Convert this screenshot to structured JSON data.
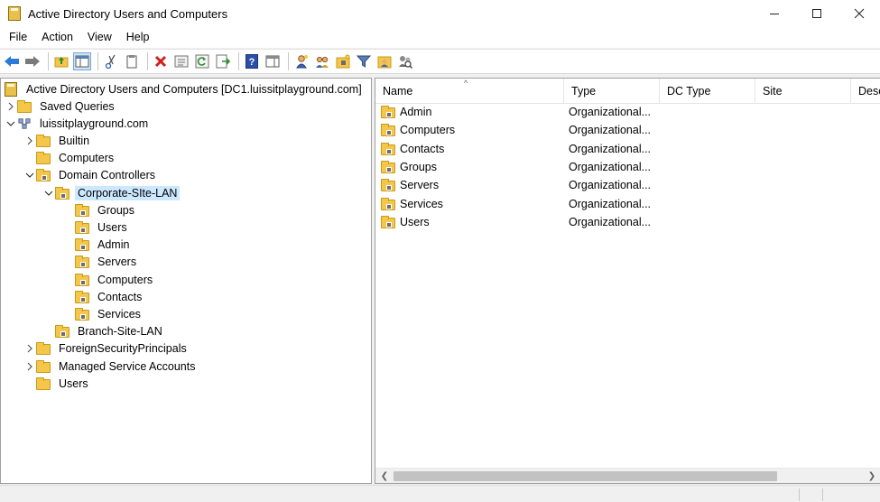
{
  "window": {
    "title": "Active Directory Users and Computers",
    "icon": "adsi-app-icon",
    "controls": [
      "minimize-icon",
      "maximize-icon",
      "close-icon"
    ]
  },
  "menu": {
    "items": [
      "File",
      "Action",
      "View",
      "Help"
    ]
  },
  "toolbar": {
    "buttons": [
      "back-arrow-icon",
      "forward-arrow-icon",
      "up-folder-icon",
      "show-hide-console-tree-icon",
      "cut-icon",
      "copy-icon",
      "delete-icon",
      "properties-icon",
      "refresh-icon",
      "export-list-icon",
      "help-icon",
      "show-action-pane-icon",
      "new-user-icon",
      "new-group-icon",
      "new-ou-icon",
      "filter-icon",
      "add-to-group-icon",
      "find-objects-icon"
    ]
  },
  "tree": {
    "root": "Active Directory Users and Computers [DC1.luissitplayground.com]",
    "items": [
      {
        "label": "Saved Queries",
        "level": 1,
        "expander": "collapsed",
        "icon": "folder"
      },
      {
        "label": "luissitplayground.com",
        "level": 1,
        "expander": "expanded",
        "icon": "domain"
      },
      {
        "label": "Builtin",
        "level": 2,
        "expander": "collapsed",
        "icon": "folder"
      },
      {
        "label": "Computers",
        "level": 2,
        "expander": "none",
        "icon": "folder"
      },
      {
        "label": "Domain Controllers",
        "level": 2,
        "expander": "expanded",
        "icon": "ou"
      },
      {
        "label": "Corporate-SIte-LAN",
        "level": 3,
        "expander": "expanded",
        "icon": "ou",
        "selected": true
      },
      {
        "label": "Groups",
        "level": 4,
        "expander": "none",
        "icon": "ou"
      },
      {
        "label": "Users",
        "level": 4,
        "expander": "none",
        "icon": "ou"
      },
      {
        "label": "Admin",
        "level": 4,
        "expander": "none",
        "icon": "ou"
      },
      {
        "label": "Servers",
        "level": 4,
        "expander": "none",
        "icon": "ou"
      },
      {
        "label": "Computers",
        "level": 4,
        "expander": "none",
        "icon": "ou"
      },
      {
        "label": "Contacts",
        "level": 4,
        "expander": "none",
        "icon": "ou"
      },
      {
        "label": "Services",
        "level": 4,
        "expander": "none",
        "icon": "ou"
      },
      {
        "label": "Branch-Site-LAN",
        "level": 3,
        "expander": "none",
        "icon": "ou"
      },
      {
        "label": "ForeignSecurityPrincipals",
        "level": 2,
        "expander": "collapsed",
        "icon": "folder"
      },
      {
        "label": "Managed Service Accounts",
        "level": 2,
        "expander": "collapsed",
        "icon": "folder"
      },
      {
        "label": "Users",
        "level": 2,
        "expander": "none",
        "icon": "folder"
      }
    ]
  },
  "list": {
    "columns": [
      "Name",
      "Type",
      "DC Type",
      "Site",
      "Desc"
    ],
    "rows": [
      {
        "name": "Admin",
        "type": "Organizational..."
      },
      {
        "name": "Computers",
        "type": "Organizational..."
      },
      {
        "name": "Contacts",
        "type": "Organizational..."
      },
      {
        "name": "Groups",
        "type": "Organizational..."
      },
      {
        "name": "Servers",
        "type": "Organizational..."
      },
      {
        "name": "Services",
        "type": "Organizational..."
      },
      {
        "name": "Users",
        "type": "Organizational..."
      }
    ]
  },
  "colors": {
    "selection": "#cce8ff",
    "folder": "#f4c64a",
    "folder_border": "#c99a1a"
  }
}
